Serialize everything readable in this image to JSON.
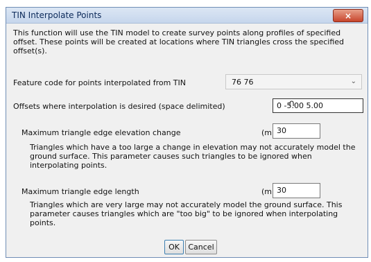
{
  "dialog": {
    "title": "TIN Interpolate Points",
    "close_label": "×",
    "intro_text": "This function will use the TIN model to create survey points along profiles of specified offset. These points will be created at locations where TIN triangles cross the specified offset(s).",
    "feature_code": {
      "label": "Feature code for points interpolated from TIN",
      "selected_value": "76 76"
    },
    "offsets": {
      "label": "Offsets where interpolation is desired (space delimited)",
      "value": "0 -5.00 5.00"
    },
    "max_elevation_change": {
      "label": "Maximum triangle edge elevation change",
      "unit": "(m)",
      "value": "30",
      "description": "Triangles which have a too large a change in elevation  may not accurately model the ground surface.  This parameter causes such triangles to be ignored when interpolating points."
    },
    "max_edge_length": {
      "label": "Maximum triangle edge length",
      "unit": "(m)",
      "value": "30",
      "description": "Triangles which are very large may not accurately model the ground surface.  This parameter causes triangles which are \"too big\" to be ignored when interpolating points."
    },
    "buttons": {
      "ok": "OK",
      "cancel": "Cancel"
    }
  }
}
